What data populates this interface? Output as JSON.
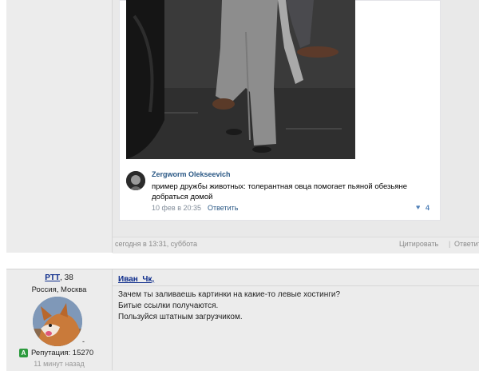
{
  "post1": {
    "comment": {
      "author": "Zergworm Olekseevich",
      "text": "пример дружбы животных: толерантная овца помогает пьяной обезьяне добраться домой",
      "date": "10 фев в 20:35",
      "reply_label": "Ответить",
      "likes": "4",
      "like_icon": "heart-icon"
    },
    "footer": {
      "time": "сегодня в 13:31, суббота",
      "quote_label": "Цитировать",
      "separator": "|",
      "reply_label": "Ответить"
    }
  },
  "post2": {
    "user": {
      "name": "PTT",
      "age": ", 38",
      "location": "Россия, Москва",
      "dash": "-",
      "reputation_badge": "A",
      "reputation": "Репутация: 15270",
      "online": "11 минут назад"
    },
    "quote_author": "Иван_Чк,",
    "lines": [
      "Зачем ты заливаешь картинки на какие-то левые хостинги?",
      "Битые ссылки получаются.",
      "Пользуйся штатным загрузчиком."
    ]
  },
  "colors": {
    "link": "#2a5885",
    "username": "#0b2a8a",
    "badge": "#2c9a3d",
    "like": "#5181b8"
  }
}
